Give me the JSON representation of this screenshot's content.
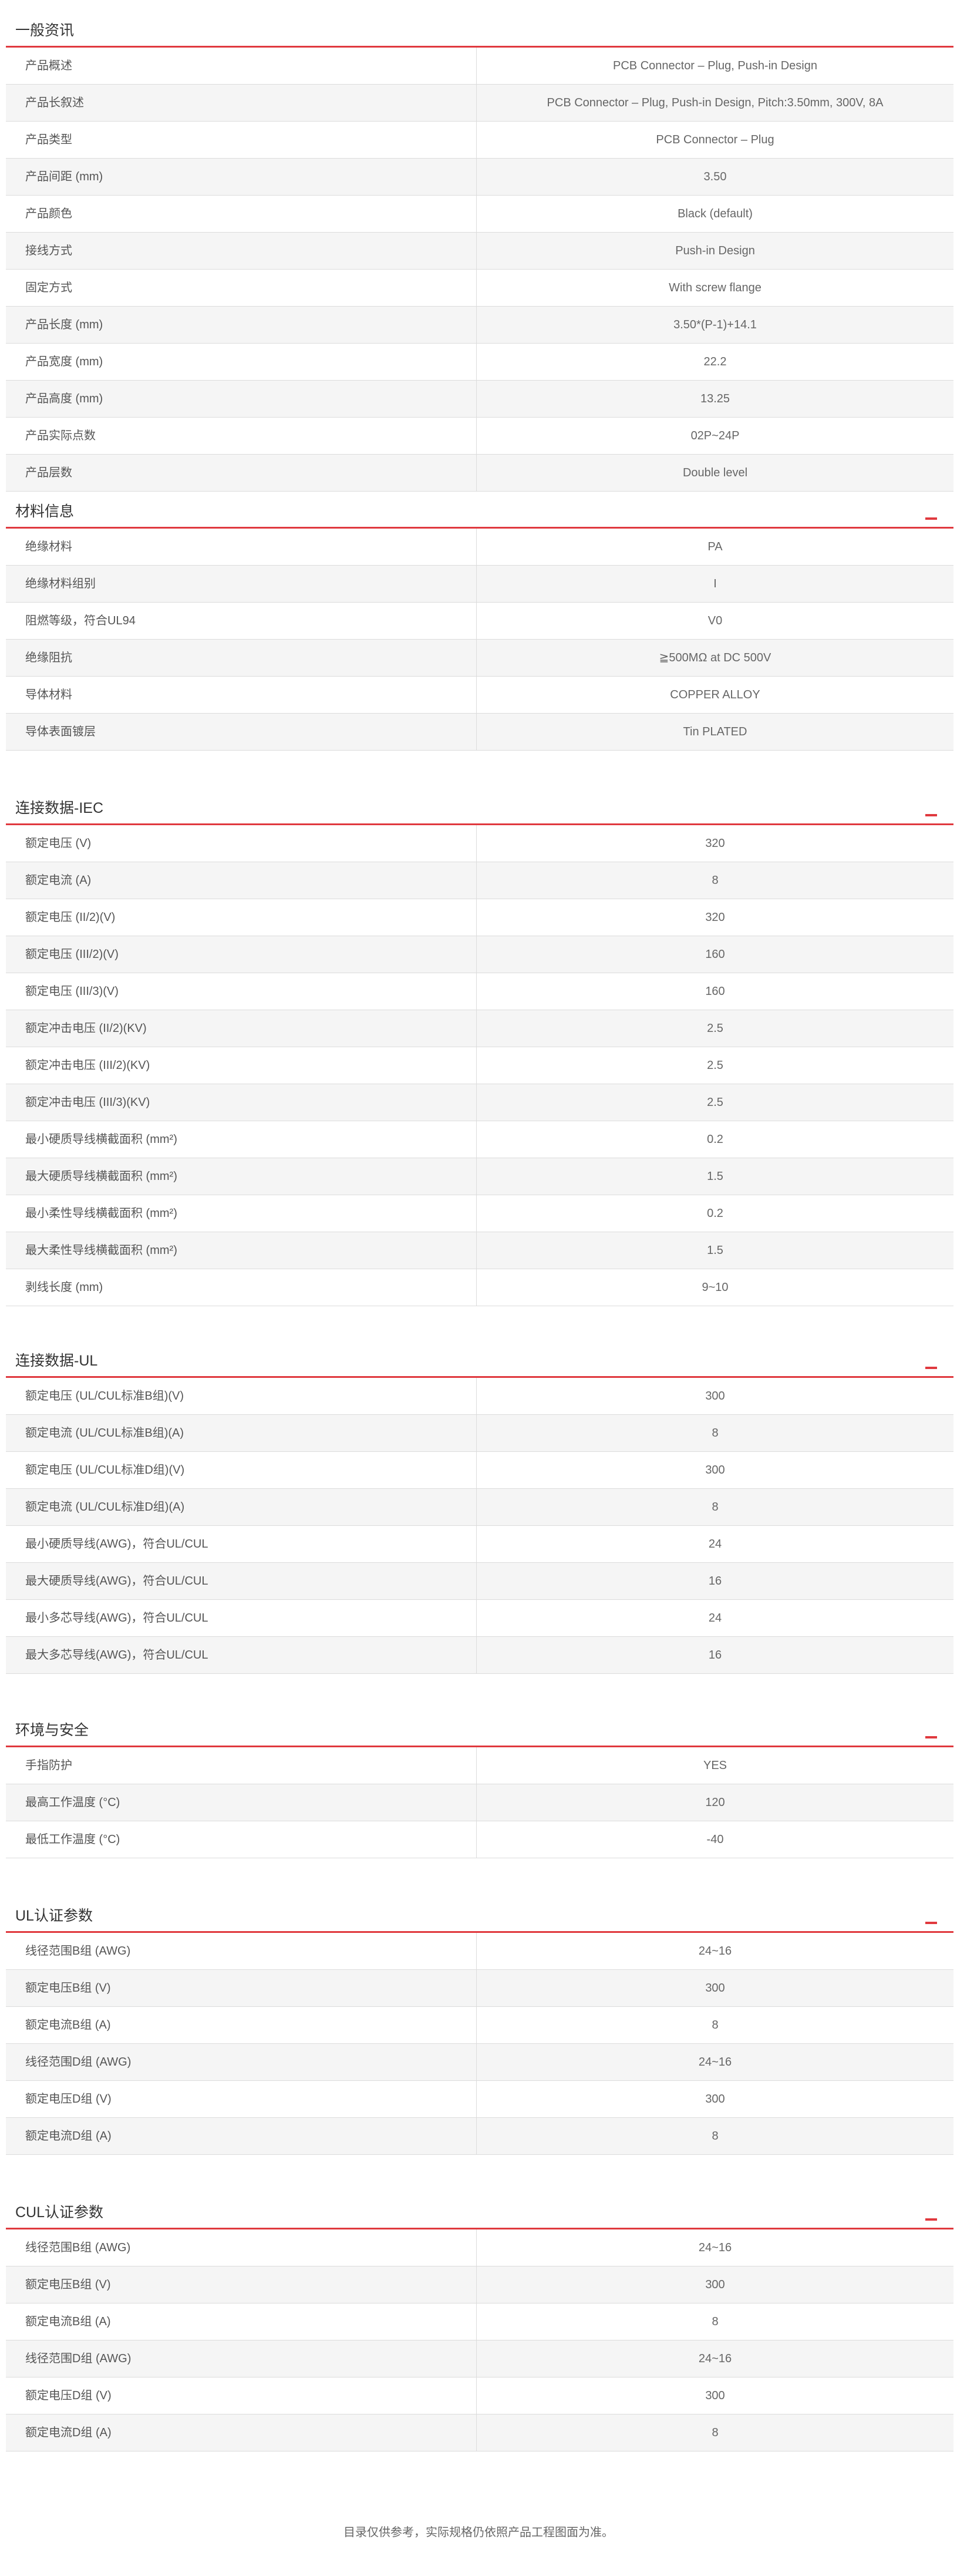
{
  "sections": [
    {
      "title": "一般资讯",
      "rows": [
        {
          "label": "产品概述",
          "value": "PCB Connector – Plug, Push-in Design"
        },
        {
          "label": "产品长叙述",
          "value": "PCB Connector – Plug, Push-in Design, Pitch:3.50mm, 300V, 8A"
        },
        {
          "label": "产品类型",
          "value": "PCB Connector – Plug"
        },
        {
          "label": "产品间距 (mm)",
          "value": "3.50"
        },
        {
          "label": "产品颜色",
          "value": "Black (default)"
        },
        {
          "label": "接线方式",
          "value": "Push-in Design"
        },
        {
          "label": "固定方式",
          "value": "With screw flange"
        },
        {
          "label": "产品长度 (mm)",
          "value": "3.50*(P-1)+14.1"
        },
        {
          "label": "产品宽度 (mm)",
          "value": "22.2"
        },
        {
          "label": "产品高度 (mm)",
          "value": "13.25"
        },
        {
          "label": "产品实际点数",
          "value": "02P~24P"
        },
        {
          "label": "产品层数",
          "value": "Double level"
        }
      ]
    },
    {
      "title": "材料信息",
      "rows": [
        {
          "label": "绝缘材料",
          "value": "PA"
        },
        {
          "label": "绝缘材料组别",
          "value": "I"
        },
        {
          "label": "阻燃等级，符合UL94",
          "value": "V0"
        },
        {
          "label": "绝缘阻抗",
          "value": "≧500MΩ at DC 500V"
        },
        {
          "label": "导体材料",
          "value": "COPPER ALLOY"
        },
        {
          "label": "导体表面镀层",
          "value": "Tin PLATED"
        }
      ]
    },
    {
      "title": "连接数据-IEC",
      "rows": [
        {
          "label": "额定电压 (V)",
          "value": "320"
        },
        {
          "label": "额定电流 (A)",
          "value": "8"
        },
        {
          "label": "额定电压 (II/2)(V)",
          "value": "320"
        },
        {
          "label": "额定电压 (III/2)(V)",
          "value": "160"
        },
        {
          "label": "额定电压 (III/3)(V)",
          "value": "160"
        },
        {
          "label": "额定冲击电压 (II/2)(KV)",
          "value": "2.5"
        },
        {
          "label": "额定冲击电压 (III/2)(KV)",
          "value": "2.5"
        },
        {
          "label": "额定冲击电压 (III/3)(KV)",
          "value": "2.5"
        },
        {
          "label": "最小硬质导线横截面积 (mm²)",
          "value": "0.2"
        },
        {
          "label": "最大硬质导线横截面积 (mm²)",
          "value": "1.5"
        },
        {
          "label": "最小柔性导线横截面积 (mm²)",
          "value": "0.2"
        },
        {
          "label": "最大柔性导线横截面积 (mm²)",
          "value": "1.5"
        },
        {
          "label": "剥线长度 (mm)",
          "value": "9~10"
        }
      ]
    },
    {
      "title": "连接数据-UL",
      "rows": [
        {
          "label": "额定电压 (UL/CUL标准B组)(V)",
          "value": "300"
        },
        {
          "label": "额定电流 (UL/CUL标准B组)(A)",
          "value": "8"
        },
        {
          "label": "额定电压 (UL/CUL标准D组)(V)",
          "value": "300"
        },
        {
          "label": "额定电流 (UL/CUL标准D组)(A)",
          "value": "8"
        },
        {
          "label": "最小硬质导线(AWG)，符合UL/CUL",
          "value": "24"
        },
        {
          "label": "最大硬质导线(AWG)，符合UL/CUL",
          "value": "16"
        },
        {
          "label": "最小多芯导线(AWG)，符合UL/CUL",
          "value": "24"
        },
        {
          "label": "最大多芯导线(AWG)，符合UL/CUL",
          "value": "16"
        }
      ]
    },
    {
      "title": "环境与安全",
      "rows": [
        {
          "label": "手指防护",
          "value": "YES"
        },
        {
          "label": "最高工作温度 (°C)",
          "value": "120"
        },
        {
          "label": "最低工作温度 (°C)",
          "value": "-40"
        }
      ]
    },
    {
      "title": "UL认证参数",
      "rows": [
        {
          "label": "线径范围B组 (AWG)",
          "value": "24~16"
        },
        {
          "label": "额定电压B组 (V)",
          "value": "300"
        },
        {
          "label": "额定电流B组 (A)",
          "value": "8"
        },
        {
          "label": "线径范围D组 (AWG)",
          "value": "24~16"
        },
        {
          "label": "额定电压D组 (V)",
          "value": "300"
        },
        {
          "label": "额定电流D组 (A)",
          "value": "8"
        }
      ]
    },
    {
      "title": "CUL认证参数",
      "rows": [
        {
          "label": "线径范围B组 (AWG)",
          "value": "24~16"
        },
        {
          "label": "额定电压B组 (V)",
          "value": "300"
        },
        {
          "label": "额定电流B组 (A)",
          "value": "8"
        },
        {
          "label": "线径范围D组 (AWG)",
          "value": "24~16"
        },
        {
          "label": "额定电压D组 (V)",
          "value": "300"
        },
        {
          "label": "额定电流D组 (A)",
          "value": "8"
        }
      ]
    }
  ],
  "footer_note": "目录仅供参考，实际规格仍依照产品工程图面为准。",
  "colors": {
    "accent": "#e0393e",
    "row_alt": "#f5f5f5",
    "border": "#dcdcdc"
  }
}
